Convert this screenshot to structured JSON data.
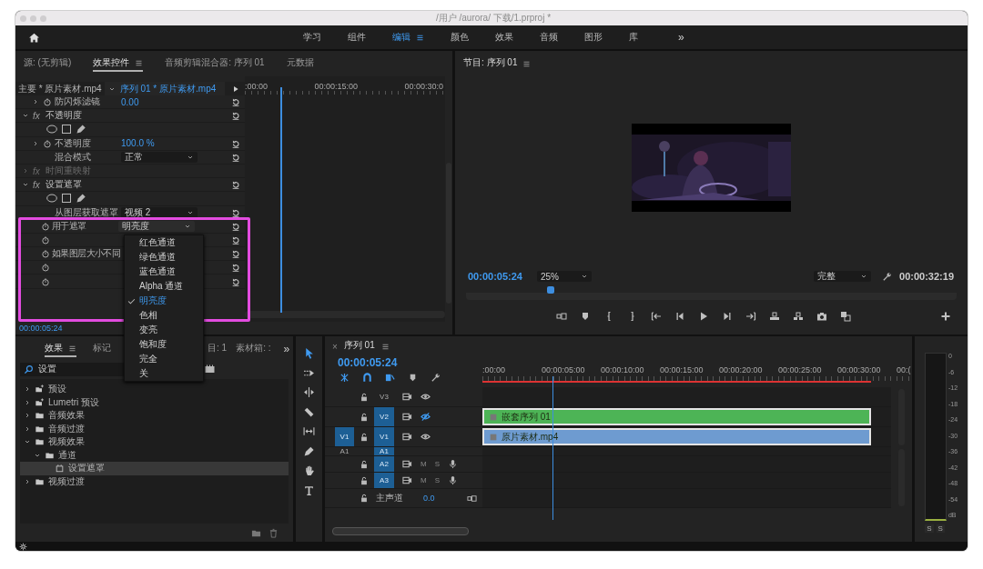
{
  "window": {
    "title": "/用户 /aurora/ 下载/1.prproj *"
  },
  "workspaces": [
    {
      "label": "学习",
      "selected": false
    },
    {
      "label": "组件",
      "selected": false
    },
    {
      "label": "编辑",
      "selected": true
    },
    {
      "label": "颜色",
      "selected": false
    },
    {
      "label": "效果",
      "selected": false
    },
    {
      "label": "音频",
      "selected": false
    },
    {
      "label": "图形",
      "selected": false
    },
    {
      "label": "库",
      "selected": false
    }
  ],
  "workspace_more": "»",
  "effect_controls": {
    "tabs": [
      {
        "label": "源: (无剪辑)",
        "selected": false
      },
      {
        "label": "效果控件",
        "selected": true
      },
      {
        "label": "音频剪辑混合器: 序列 01",
        "selected": false
      },
      {
        "label": "元数据",
        "selected": false
      }
    ],
    "master_clip": "主要 * 原片素材.mp4",
    "sequence_clip": "序列 01 * 原片素材.mp4",
    "ruler": [
      ":00:00",
      "00:00:15:00",
      "00:00:30:0"
    ],
    "rows": [
      {
        "kind": "param",
        "label": "防闪烁滤镜",
        "value": "0.00",
        "expanded": false
      },
      {
        "kind": "effect",
        "badge": "fx",
        "label": "不透明度",
        "expanded": true,
        "disabled": false
      },
      {
        "kind": "shapes"
      },
      {
        "kind": "param",
        "label": "不透明度",
        "value": "100.0 %",
        "expanded": false
      },
      {
        "kind": "choice",
        "label": "混合模式",
        "select": "正常"
      },
      {
        "kind": "effect",
        "badge": "fx",
        "label": "时间重映射",
        "expanded": false,
        "disabled": true
      },
      {
        "kind": "effect",
        "badge": "fx",
        "label": "设置遮罩",
        "expanded": true,
        "disabled": false
      },
      {
        "kind": "shapes"
      },
      {
        "kind": "choice",
        "label": "从图层获取遮罩",
        "select": "视频 2"
      },
      {
        "kind": "keyed",
        "label": "用于遮罩",
        "select": "明亮度"
      },
      {
        "kind": "keyed"
      },
      {
        "kind": "keyed",
        "label": "如果图层大小不同"
      },
      {
        "kind": "keyed"
      },
      {
        "kind": "keyed"
      }
    ],
    "timecode": "00:00:05:24"
  },
  "dropdown_menu": {
    "items": [
      {
        "label": "红色通道",
        "selected": false
      },
      {
        "label": "绿色通道",
        "selected": false
      },
      {
        "label": "蓝色通道",
        "selected": false
      },
      {
        "label": "Alpha 通道",
        "selected": false
      },
      {
        "label": "明亮度",
        "selected": true
      },
      {
        "label": "色相",
        "selected": false
      },
      {
        "label": "变亮",
        "selected": false
      },
      {
        "label": "饱和度",
        "selected": false
      },
      {
        "label": "完全",
        "selected": false
      },
      {
        "label": "关",
        "selected": false
      }
    ]
  },
  "program": {
    "title": "节目: 序列 01",
    "timecode": "00:00:05:24",
    "zoom": "25%",
    "quality": "完整",
    "duration": "00:00:32:19"
  },
  "effects": {
    "tabs": [
      {
        "label": "效果",
        "selected": true
      },
      {
        "label": "标记",
        "selected": false
      },
      {
        "label": "目: 1",
        "selected": false
      },
      {
        "label": "素材箱: :",
        "selected": false
      }
    ],
    "more": "»",
    "search": "设置",
    "tree": [
      {
        "kind": "preset",
        "label": "预设",
        "expanded": false,
        "selected": false
      },
      {
        "kind": "preset",
        "label": "Lumetri 预设",
        "expanded": false,
        "selected": false
      },
      {
        "kind": "folder",
        "label": "音频效果",
        "expanded": false,
        "selected": false
      },
      {
        "kind": "folder",
        "label": "音频过渡",
        "expanded": false,
        "selected": false
      },
      {
        "kind": "folder",
        "label": "视频效果",
        "expanded": true,
        "selected": false,
        "children": [
          {
            "kind": "folder",
            "label": "通道",
            "expanded": true,
            "selected": false,
            "children": [
              {
                "kind": "effect",
                "label": "设置遮罩",
                "selected": true
              }
            ]
          }
        ]
      },
      {
        "kind": "folder",
        "label": "视频过渡",
        "expanded": false,
        "selected": false
      }
    ]
  },
  "tools": [
    {
      "kind": "selection",
      "selected": true
    },
    {
      "kind": "track-select",
      "selected": false
    },
    {
      "kind": "ripple",
      "selected": false
    },
    {
      "kind": "razor",
      "selected": false
    },
    {
      "kind": "slip",
      "selected": false
    },
    {
      "kind": "pen",
      "selected": false
    },
    {
      "kind": "hand",
      "selected": false
    },
    {
      "kind": "type",
      "selected": false
    }
  ],
  "timeline": {
    "close": "×",
    "title": "序列 01",
    "timecode": "00:00:05:24",
    "ruler": [
      ":00:00",
      "00:00:05:00",
      "00:00:10:00",
      "00:00:15:00",
      "00:00:20:00",
      "00:00:25:00",
      "00:00:30:00",
      "00:("
    ],
    "tracks": [
      {
        "kind": "video",
        "label": "V3",
        "targeted": false,
        "hidden": false
      },
      {
        "kind": "video",
        "label": "V2",
        "targeted": true,
        "hidden": true,
        "clip": {
          "label": "嵌套序列 01",
          "color": "#4db456"
        }
      },
      {
        "kind": "video",
        "label": "V1",
        "targeted": true,
        "hidden": false,
        "source": {
          "label": "V1",
          "on": true
        },
        "clip": {
          "label": "原片素材.mp4",
          "color": "#6e9bd0"
        }
      },
      {
        "kind": "squeezed",
        "label": "A1",
        "targeted": true,
        "source": {
          "label": "A1",
          "on": false
        }
      },
      {
        "kind": "audio",
        "label": "A2",
        "targeted": true,
        "mute": "M",
        "solo": "S"
      },
      {
        "kind": "audio",
        "label": "A3",
        "targeted": true,
        "mute": "M",
        "solo": "S"
      }
    ],
    "master": {
      "label": "主声道",
      "value": "0.0"
    }
  },
  "meter": {
    "scale": [
      "0",
      "-6",
      "-12",
      "-18",
      "-24",
      "-30",
      "-36",
      "-42",
      "-48",
      "-54",
      "dB"
    ],
    "solo": [
      "S",
      "S"
    ]
  }
}
